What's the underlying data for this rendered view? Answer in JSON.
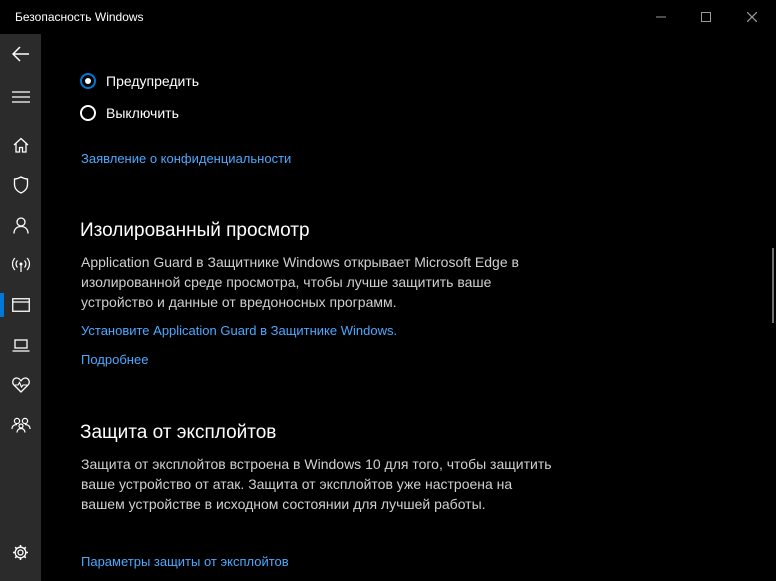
{
  "window": {
    "title": "Безопасность Windows",
    "controls": [
      "minimize-icon",
      "maximize-icon",
      "close-icon"
    ]
  },
  "sidebar": {
    "items": [
      {
        "icon": "back-arrow-icon"
      },
      {
        "icon": "hamburger-menu-icon"
      },
      {
        "icon": "home-icon"
      },
      {
        "icon": "shield-icon"
      },
      {
        "icon": "person-icon"
      },
      {
        "icon": "wireless-signal-icon"
      },
      {
        "icon": "app-browser-icon",
        "selected": true
      },
      {
        "icon": "laptop-icon"
      },
      {
        "icon": "heart-health-icon"
      },
      {
        "icon": "family-icon"
      },
      {
        "icon": "gear-icon"
      }
    ],
    "accent_color": "#0078d7"
  },
  "main": {
    "radio_options": [
      {
        "label": "Предупредить",
        "checked": true
      },
      {
        "label": "Выключить",
        "checked": false
      }
    ],
    "privacy_link": "Заявление о конфиденциальности",
    "isolated_browsing": {
      "heading": "Изолированный просмотр",
      "description": "Application Guard в Защитнике Windows открывает Microsoft Edge в изолированной среде просмотра, чтобы лучше защитить ваше устройство и данные от вредоносных программ.",
      "install_link": "Установите Application Guard в Защитнике Windows.",
      "more_link": "Подробнее"
    },
    "exploit_protection": {
      "heading": "Защита от эксплойтов",
      "description": "Защита от эксплойтов встроена в Windows 10 для того, чтобы защитить ваше устройство от атак. Защита от эксплойтов уже настроена на вашем устройстве в исходном состоянии для лучшей работы.",
      "settings_link": "Параметры защиты от эксплойтов"
    }
  },
  "colors": {
    "link": "#4ca8ff",
    "background": "#000000",
    "sidebar": "#2b2b2b"
  }
}
